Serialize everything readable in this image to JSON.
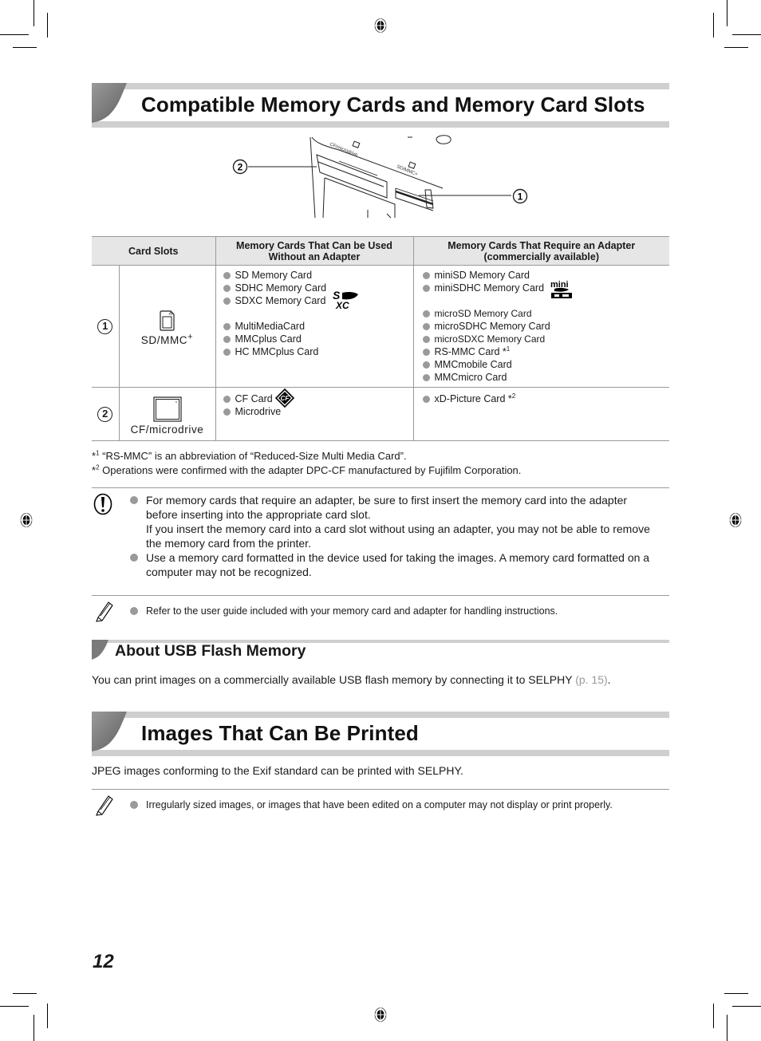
{
  "section1": {
    "title": "Compatible Memory Cards and Memory Card Slots",
    "figure": {
      "callouts": [
        "2",
        "1"
      ],
      "slot_labels": [
        "CF/microdrive",
        "SD/MMC+"
      ]
    }
  },
  "table": {
    "headers": [
      "Card Slots",
      "Memory Cards That Can be Used Without an Adapter",
      "Memory Cards That Require an Adapter (commercially available)"
    ],
    "header_lines": {
      "col2": [
        "Memory Cards That Can be Used",
        "Without an Adapter"
      ],
      "col3": [
        "Memory Cards That Require an Adapter",
        "(commercially available)"
      ]
    },
    "rows": [
      {
        "number": "1",
        "slot_icon": "sd-card-icon",
        "slot_name": "SD/MMC",
        "slot_name_suffix": "+",
        "without_adapter": [
          "SD Memory Card",
          "SDHC Memory Card",
          "SDXC Memory Card",
          "MultiMediaCard",
          "MMCplus Card",
          "HC MMCplus Card"
        ],
        "with_adapter": [
          "miniSD Memory Card",
          "miniSDHC Memory Card",
          "microSD Memory Card",
          "microSDHC Memory Card",
          "microSDXC Memory Card",
          "RS-MMC Card *",
          "MMCmobile Card",
          "MMCmicro Card"
        ],
        "footnote_marks": {
          "RS-MMC Card": "1"
        }
      },
      {
        "number": "2",
        "slot_icon": "cf-card-icon",
        "slot_name": "CF/microdrive",
        "without_adapter": [
          "CF Card",
          "Microdrive"
        ],
        "with_adapter": [
          "xD-Picture Card *"
        ],
        "footnote_marks": {
          "xD-Picture Card": "2"
        }
      }
    ]
  },
  "footnotes": [
    {
      "mark": "*",
      "num": "1",
      "text": " “RS-MMC” is an abbreviation of “Reduced-Size Multi Media Card”."
    },
    {
      "mark": "*",
      "num": "2",
      "text": " Operations were confirmed with the adapter DPC-CF manufactured by Fujifilm Corporation."
    }
  ],
  "caution": {
    "icon": "caution-icon",
    "items": [
      "For memory cards that require an adapter, be sure to first insert the memory card into the adapter before inserting into the appropriate card slot.",
      "If you insert the memory card into a card slot without using an adapter, you may not be able to remove the memory card from the printer.",
      "Use a memory card formatted in the device used for taking the images. A memory card formatted on a computer may not be recognized."
    ]
  },
  "memo1": {
    "icon": "pencil-icon",
    "items": [
      "Refer to the user guide included with your memory card and adapter for handling instructions."
    ]
  },
  "section_usb": {
    "title": "About USB Flash Memory",
    "text": "You can print images on a commercially available USB flash memory by connecting it to SELPHY ",
    "link": "(p. 15)",
    "text_end": "."
  },
  "section2": {
    "title": "Images That Can Be Printed",
    "text": "JPEG images conforming to the Exif standard can be printed with SELPHY."
  },
  "memo2": {
    "icon": "pencil-icon",
    "items": [
      "Irregularly sized images, or images that have been edited on a computer may not display or print properly."
    ]
  },
  "page_number": "12"
}
